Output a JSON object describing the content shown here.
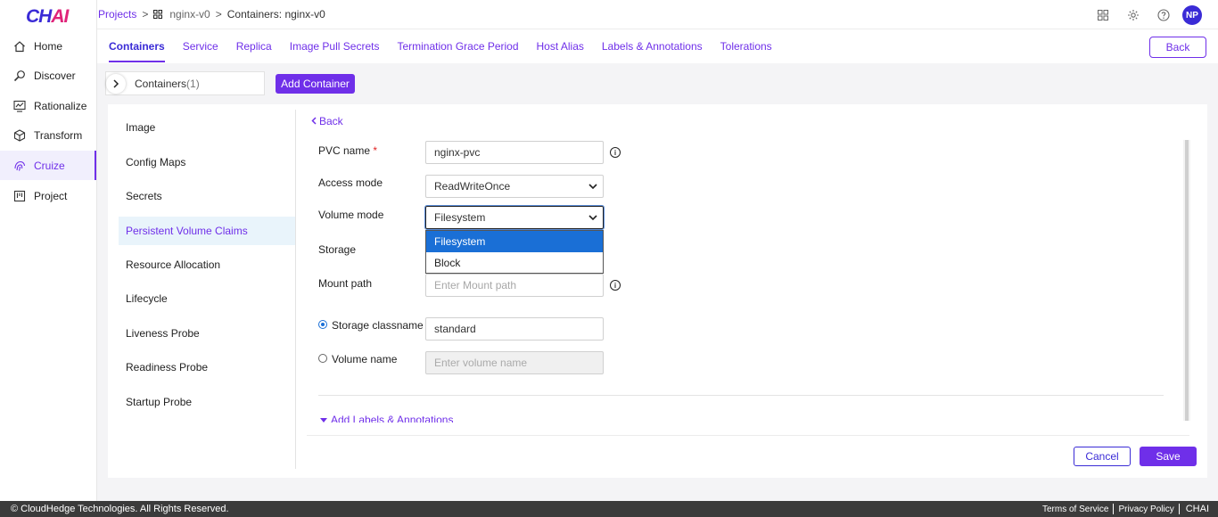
{
  "app": {
    "logo_main": "CH",
    "logo_accent": "AI"
  },
  "sidebar": {
    "items": [
      {
        "label": "Home",
        "icon": "home-icon"
      },
      {
        "label": "Discover",
        "icon": "discover-icon"
      },
      {
        "label": "Rationalize",
        "icon": "rationalize-icon"
      },
      {
        "label": "Transform",
        "icon": "cube-icon"
      },
      {
        "label": "Cruize",
        "icon": "fingerprint-icon"
      },
      {
        "label": "Project",
        "icon": "project-icon"
      }
    ]
  },
  "breadcrumb": {
    "projects": "Projects",
    "sep1": ">",
    "project": "nginx-v0",
    "sep2": ">",
    "current": "Containers: nginx-v0"
  },
  "topbar": {
    "avatar": "NP"
  },
  "tabs": [
    "Containers",
    "Service",
    "Replica",
    "Image Pull Secrets",
    "Termination Grace Period",
    "Host Alias",
    "Labels & Annotations",
    "Tolerations"
  ],
  "back_button": "Back",
  "containers": {
    "label": "Containers",
    "count": "(1)",
    "add_button": "Add Container"
  },
  "left_menu": [
    "Image",
    "Config Maps",
    "Secrets",
    "Persistent Volume Claims",
    "Resource Allocation",
    "Lifecycle",
    "Liveness Probe",
    "Readiness Probe",
    "Startup Probe"
  ],
  "form": {
    "back_link": "Back",
    "pvc_name_label": "PVC name",
    "required_mark": "*",
    "pvc_name_value": "nginx-pvc",
    "access_mode_label": "Access mode",
    "access_mode_value": "ReadWriteOnce",
    "volume_mode_label": "Volume mode",
    "volume_mode_value": "Filesystem",
    "volume_mode_options": [
      "Filesystem",
      "Block"
    ],
    "storage_label": "Storage",
    "mount_path_label": "Mount path",
    "mount_path_placeholder": "Enter Mount path",
    "storage_classname_label": "Storage classname",
    "storage_classname_value": "standard",
    "volume_name_label": "Volume name",
    "volume_name_placeholder": "Enter volume name",
    "add_labels": "Add Labels & Annotations",
    "cancel": "Cancel",
    "save": "Save"
  },
  "footer": {
    "copyright": "© CloudHedge Technologies. All Rights Reserved.",
    "terms": "Terms of Service",
    "privacy": "Privacy Policy",
    "brand": "CHAI"
  },
  "colors": {
    "accent": "#6f2fe9",
    "brand_blue": "#3a2bd6",
    "selected_option": "#1a6fd6",
    "footer_bg": "#3b3b3b"
  }
}
